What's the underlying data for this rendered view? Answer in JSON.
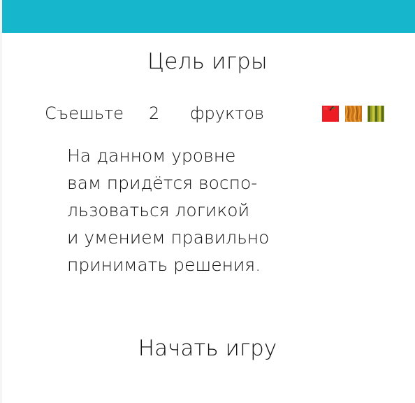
{
  "header": {
    "bar_color": "#16b7cd"
  },
  "goal": {
    "title": "Цель игры",
    "verb": "Съешьте",
    "count": "2",
    "noun": "фруктов",
    "fruit_icons": [
      "apple-icon",
      "orange-icon",
      "melon-icon"
    ]
  },
  "description": {
    "lines": [
      "На данном уровне",
      "вам придётся воспо-",
      "льзоваться логикой",
      "и умением правильно",
      "принимать решения."
    ]
  },
  "actions": {
    "start_label": "Начать игру"
  }
}
